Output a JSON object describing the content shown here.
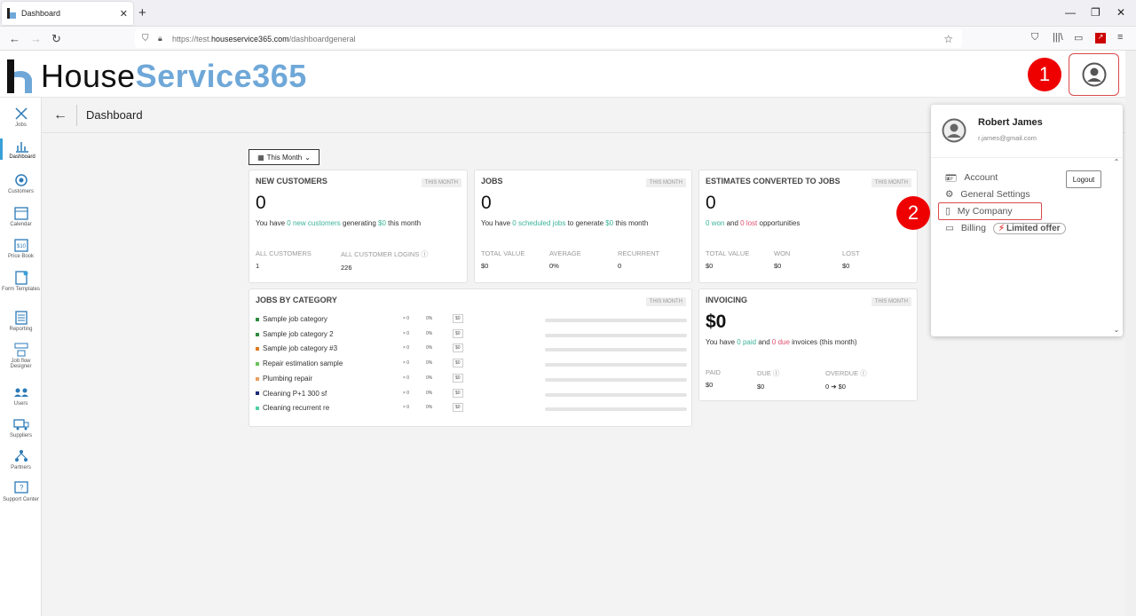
{
  "browser": {
    "tab_title": "Dashboard",
    "close_tab": "✕",
    "new_tab": "+",
    "url_prefix": "https://test.",
    "url_domain": "houseservice365.com",
    "url_path": "/dashboardgeneral"
  },
  "brand": {
    "name_part1": "House",
    "name_part2": "Service365",
    "accent": "#6fa8d8"
  },
  "header": {
    "page_title": "Dashboard"
  },
  "sidebar": {
    "items": [
      {
        "label": "Jobs"
      },
      {
        "label": "Dashboard"
      },
      {
        "label": "Customers"
      },
      {
        "label": "Calendar"
      },
      {
        "label": "Price Book"
      },
      {
        "label": "Form Templates"
      },
      {
        "label": "Reporting"
      },
      {
        "label": "Job flow Designer"
      },
      {
        "label": "Users"
      },
      {
        "label": "Suppliers"
      },
      {
        "label": "Partners"
      },
      {
        "label": "Support Center"
      }
    ]
  },
  "filters": {
    "period": "This Month"
  },
  "cards": {
    "new_customers": {
      "title": "NEW CUSTOMERS",
      "badge": "THIS MONTH",
      "value": "0",
      "d1": "You have ",
      "d2": "0 new customers",
      "d3": " generating ",
      "d4": "$0",
      "d5": " this month",
      "s1_label": "ALL CUSTOMERS",
      "s1_value": "1",
      "s2_label": "ALL CUSTOMER LOGINS ⓘ",
      "s2_value": "226"
    },
    "jobs": {
      "title": "JOBS",
      "badge": "THIS MONTH",
      "value": "0",
      "d1": "You have ",
      "d2": "0 scheduled jobs",
      "d3": " to generate ",
      "d4": "$0",
      "d5": " this month",
      "s1_label": "TOTAL VALUE",
      "s1_value": "$0",
      "s2_label": "AVERAGE",
      "s2_value": "0%",
      "s3_label": "RECURRENT",
      "s3_value": "0"
    },
    "estimates": {
      "title": "ESTIMATES CONVERTED TO JOBS",
      "badge": "THIS MONTH",
      "value": "0",
      "d1": "0 won",
      "d2": " and ",
      "d3": "0 lost",
      "d4": " opportunities",
      "s1_label": "TOTAL VALUE",
      "s1_value": "$0",
      "s2_label": "WON",
      "s2_value": "$0",
      "s3_label": "LOST",
      "s3_value": "$0"
    },
    "categories": {
      "title": "JOBS BY CATEGORY",
      "badge": "THIS MONTH",
      "rows": [
        {
          "name": "Sample job category",
          "count": "× 0",
          "pct": "0%",
          "amount": "$0",
          "color": "#2e8b3e"
        },
        {
          "name": "Sample job category 2",
          "count": "× 0",
          "pct": "0%",
          "amount": "$0",
          "color": "#2e8b3e"
        },
        {
          "name": "Sample job category #3",
          "count": "× 0",
          "pct": "0%",
          "amount": "$0",
          "color": "#e07a20"
        },
        {
          "name": "Repair estimation sample",
          "count": "× 0",
          "pct": "0%",
          "amount": "$0",
          "color": "#6ac259"
        },
        {
          "name": "Plumbing repair",
          "count": "× 0",
          "pct": "0%",
          "amount": "$0",
          "color": "#e8a060"
        },
        {
          "name": "Cleaning P+1 300 sf",
          "count": "× 0",
          "pct": "0%",
          "amount": "$0",
          "color": "#1a2a7a"
        },
        {
          "name": "Cleaning recurrent re",
          "count": "× 0",
          "pct": "0%",
          "amount": "$0",
          "color": "#4fd0a8"
        }
      ]
    },
    "invoicing": {
      "title": "INVOICING",
      "badge": "THIS MONTH",
      "value": "$0",
      "d1": "You have ",
      "d2": "0 paid",
      "d3": " and ",
      "d4": "0 due",
      "d5": " invoices (this month)",
      "s1_label": "PAID",
      "s1_value": "$0",
      "s2_label": "DUE ⓘ",
      "s2_value": "$0",
      "s3_label": "OVERDUE ⓘ",
      "s3_value": "0 ➔ $0"
    }
  },
  "user_menu": {
    "name": "Robert James",
    "email": "r.james@gmail.com",
    "logout": "Logout",
    "account": "Account",
    "general_settings": "General Settings",
    "my_company": "My Company",
    "billing": "Billing",
    "offer": "Limited offer"
  },
  "annotations": {
    "step1": "1",
    "step2": "2",
    "color": "#e00000"
  }
}
